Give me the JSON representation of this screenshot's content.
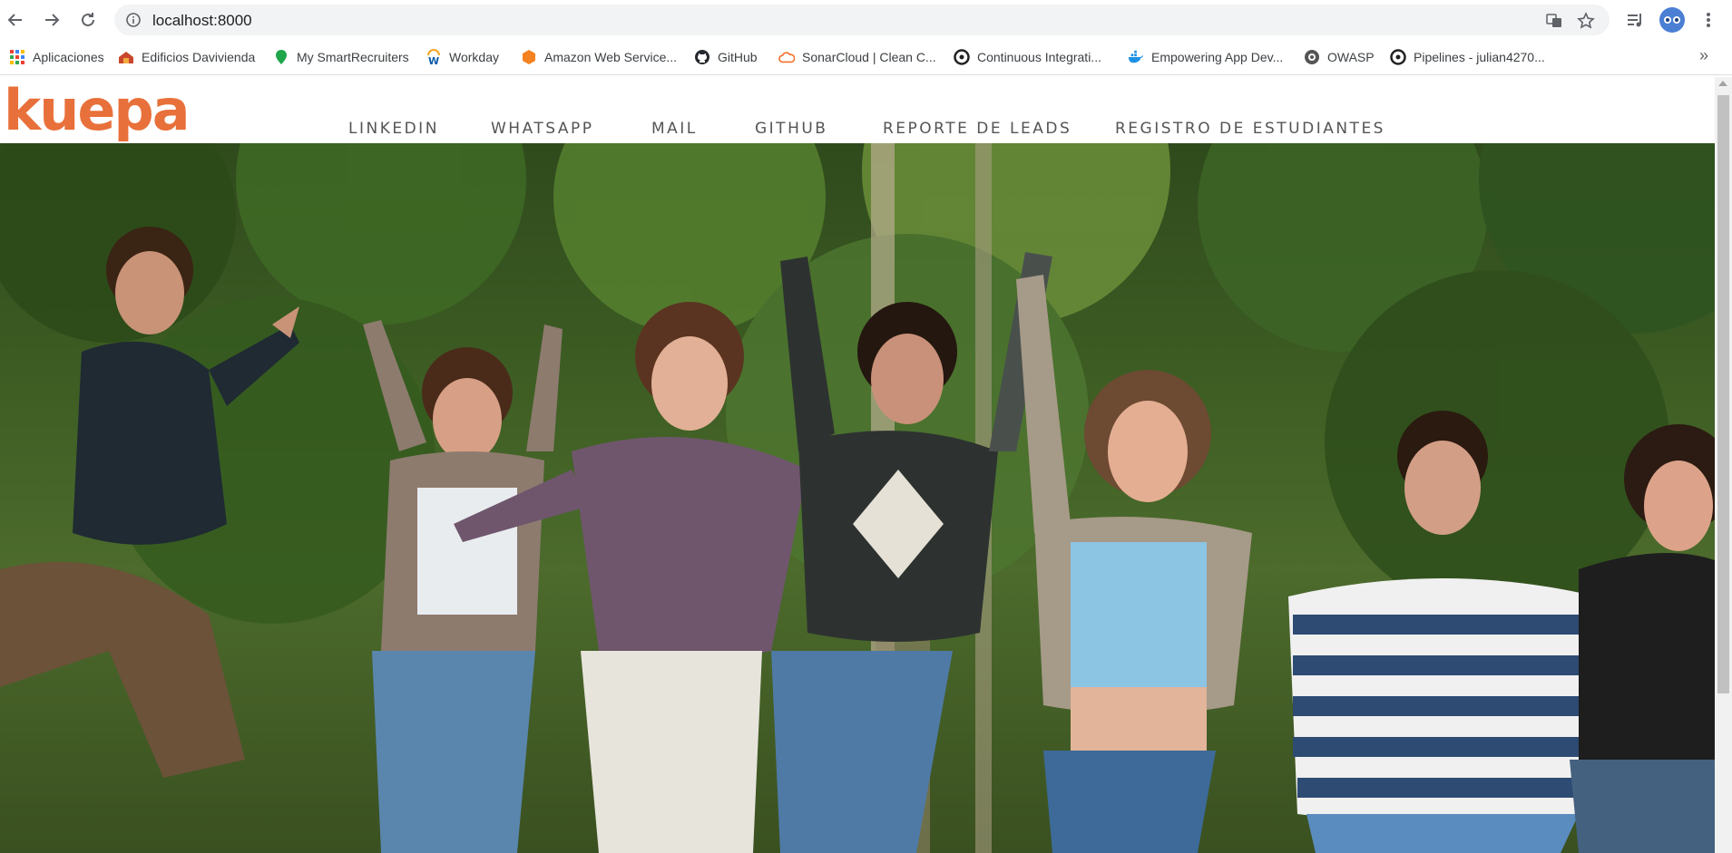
{
  "browser": {
    "url": "localhost:8000",
    "bookmarks": [
      {
        "label": "Aplicaciones",
        "icon": "apps-grid-icon"
      },
      {
        "label": "Edificios Davivienda",
        "icon": "davivienda-icon"
      },
      {
        "label": "My SmartRecruiters",
        "icon": "smartrecruiters-icon"
      },
      {
        "label": "Workday",
        "icon": "workday-icon"
      },
      {
        "label": "Amazon Web Service...",
        "icon": "aws-icon"
      },
      {
        "label": "GitHub",
        "icon": "github-icon"
      },
      {
        "label": "SonarCloud | Clean C...",
        "icon": "sonarcloud-icon"
      },
      {
        "label": "Continuous Integrati...",
        "icon": "circleci-icon"
      },
      {
        "label": "Empowering App Dev...",
        "icon": "docker-icon"
      },
      {
        "label": "OWASP",
        "icon": "owasp-icon"
      },
      {
        "label": "Pipelines - julian4270...",
        "icon": "circleci-icon"
      }
    ],
    "more_bookmarks": "»"
  },
  "site": {
    "logo": "kuepa",
    "brand_color": "#e8703a",
    "menu": [
      "LINKEDIN",
      "WHATSAPP",
      "MAIL",
      "GITHUB",
      "REPORTE DE LEADS",
      "REGISTRO DE ESTUDIANTES"
    ]
  }
}
